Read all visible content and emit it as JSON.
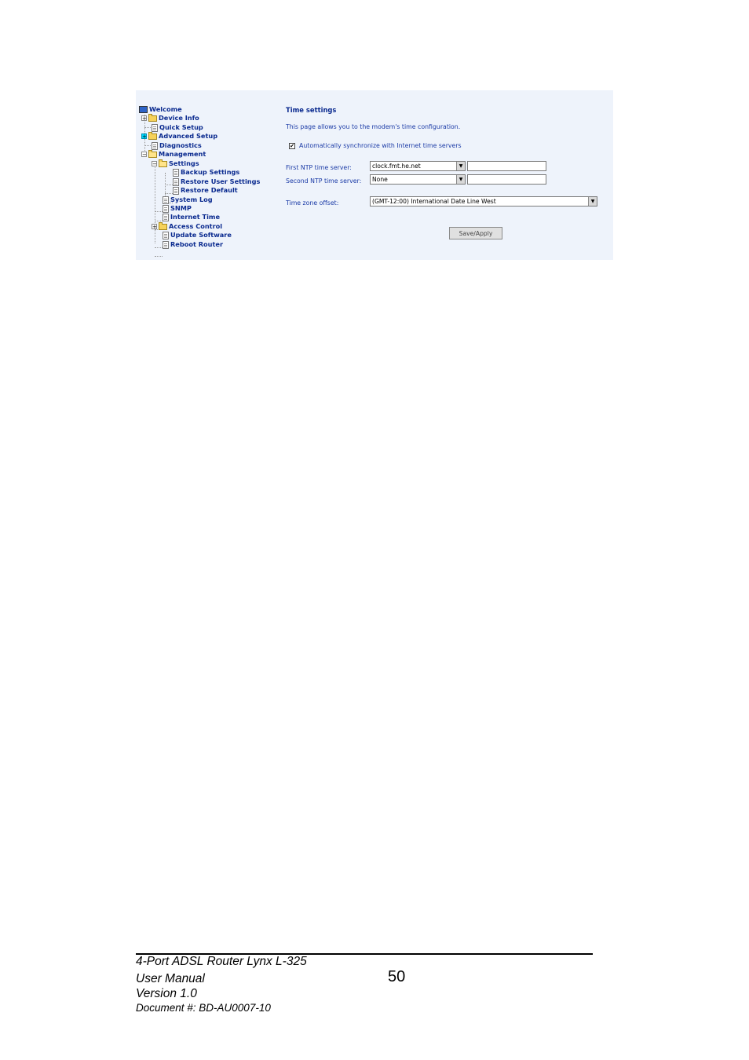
{
  "tree": {
    "welcome": "Welcome",
    "device_info": "Device Info",
    "quick_setup": "Quick Setup",
    "advanced_setup": "Advanced Setup",
    "diagnostics": "Diagnostics",
    "management": "Management",
    "settings": "Settings",
    "backup_settings": "Backup Settings",
    "restore_user_settings": "Restore User Settings",
    "restore_default": "Restore Default",
    "system_log": "System Log",
    "snmp": "SNMP",
    "internet_time": "Internet Time",
    "access_control": "Access Control",
    "update_software": "Update Software",
    "reboot_router": "Reboot Router"
  },
  "panel": {
    "title": "Time settings",
    "description": "This page allows you to the modem's time configuration.",
    "auto_sync_label": "Automatically synchronize with Internet time servers",
    "auto_sync_checked": "✔",
    "first_ntp_label": "First NTP time server:",
    "first_ntp_value": "clock.fmt.he.net",
    "second_ntp_label": "Second NTP time server:",
    "second_ntp_value": "None",
    "timezone_label": "Time zone offset:",
    "timezone_value": "(GMT-12:00) International Date Line West",
    "save_button": "Save/Apply"
  },
  "footer": {
    "line1": "4-Port ADSL Router Lynx L-325",
    "line2": "User Manual",
    "line3": "Version 1.0",
    "line4": "Document #:  BD-AU0007-10",
    "page_number": "50"
  }
}
